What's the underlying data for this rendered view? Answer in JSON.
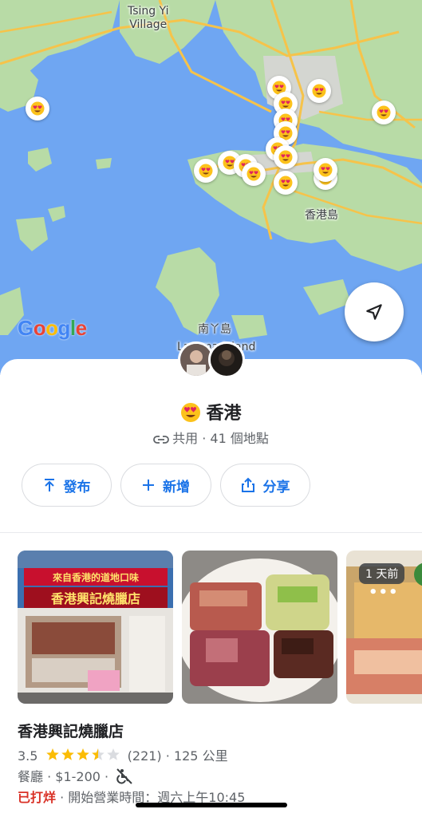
{
  "map": {
    "labels": {
      "tsing_yi": "Tsing Yi\nVillage",
      "hk_island": "香港島",
      "lamma_cn": "南丫島",
      "lamma_en": "Lamma Island"
    },
    "google_logo": [
      "G",
      "o",
      "o",
      "g",
      "l",
      "e"
    ],
    "google_colors": [
      "#4285F4",
      "#EA4335",
      "#FBBC05",
      "#4285F4",
      "#34A853",
      "#EA4335"
    ],
    "pin_icon": "smiling-face-with-heart-eyes",
    "locate_icon": "navigation-arrow-icon"
  },
  "sheet": {
    "title": "香港",
    "title_icon": "smiling-face-with-heart-eyes",
    "meta": "共用 · 41 個地點",
    "buttons": {
      "publish": "發布",
      "add": "新增",
      "share": "分享"
    },
    "photo_badge": "1 天前",
    "photo_more": "•••",
    "place": {
      "name": "香港興記燒臘店",
      "rating": "3.5",
      "rating_value": 3.5,
      "reviews": "(221)",
      "distance": "· 125 公里",
      "category": "餐廳 · $1-200 ·",
      "status": "已打烊",
      "hours": "· 開始營業時間：週六上午10:45"
    },
    "sign_top": "來自香港的道地口味",
    "sign_main": "香港興記燒臘店"
  },
  "colors": {
    "accent": "#1a73e8",
    "closed": "#d93025",
    "star": "#fbbc04",
    "water": "#6fa6f2",
    "land": "#b8dba6"
  }
}
